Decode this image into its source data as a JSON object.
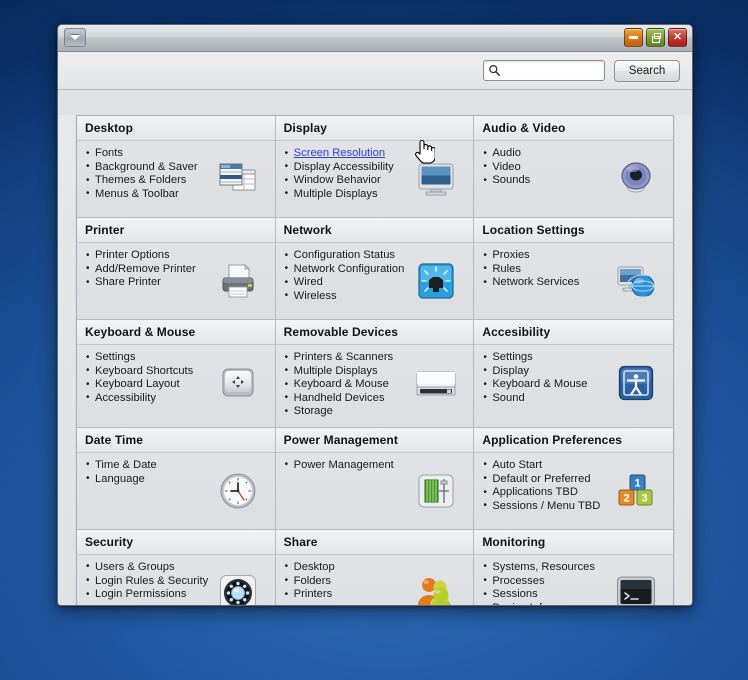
{
  "window": {
    "menu_button_icon": "chevron-down-icon",
    "minimize_label": "–",
    "maximize_label": "□",
    "close_label": "✕"
  },
  "toolbar": {
    "search_icon": "search-icon",
    "search_value": "",
    "search_placeholder": "",
    "search_button_label": "Search"
  },
  "panels": [
    {
      "title": "Desktop",
      "icon": "desktop-windows-icon",
      "items": [
        {
          "label": "Fonts",
          "link": false
        },
        {
          "label": "Background & Saver",
          "link": false
        },
        {
          "label": "Themes & Folders",
          "link": false
        },
        {
          "label": "Menus & Toolbar",
          "link": false
        }
      ]
    },
    {
      "title": "Display",
      "icon": "monitor-icon",
      "items": [
        {
          "label": "Screen Resolution",
          "link": true
        },
        {
          "label": "Display Accessibility",
          "link": false
        },
        {
          "label": "Window Behavior",
          "link": false
        },
        {
          "label": "Multiple Displays",
          "link": false
        }
      ]
    },
    {
      "title": "Audio & Video",
      "icon": "speaker-icon",
      "items": [
        {
          "label": "Audio",
          "link": false
        },
        {
          "label": "Video",
          "link": false
        },
        {
          "label": "Sounds",
          "link": false
        }
      ]
    },
    {
      "title": "Printer",
      "icon": "printer-icon",
      "items": [
        {
          "label": "Printer Options",
          "link": false
        },
        {
          "label": "Add/Remove Printer",
          "link": false
        },
        {
          "label": "Share Printer",
          "link": false
        }
      ]
    },
    {
      "title": "Network",
      "icon": "network-port-icon",
      "items": [
        {
          "label": "Configuration Status",
          "link": false
        },
        {
          "label": "Network Configuration",
          "link": false
        },
        {
          "label": "Wired",
          "link": false
        },
        {
          "label": "Wireless",
          "link": false
        }
      ]
    },
    {
      "title": "Location Settings",
      "icon": "monitor-globe-icon",
      "items": [
        {
          "label": "Proxies",
          "link": false
        },
        {
          "label": "Rules",
          "link": false
        },
        {
          "label": "Network Services",
          "link": false
        }
      ]
    },
    {
      "title": "Keyboard & Mouse",
      "icon": "keyboard-key-icon",
      "items": [
        {
          "label": "Settings",
          "link": false
        },
        {
          "label": "Keyboard Shortcuts",
          "link": false
        },
        {
          "label": "Keyboard Layout",
          "link": false
        },
        {
          "label": "Accessibility",
          "link": false
        }
      ]
    },
    {
      "title": "Removable Devices",
      "icon": "floppy-drive-icon",
      "items": [
        {
          "label": "Printers & Scanners",
          "link": false
        },
        {
          "label": "Multiple Displays",
          "link": false
        },
        {
          "label": "Keyboard & Mouse",
          "link": false
        },
        {
          "label": "Handheld Devices",
          "link": false
        },
        {
          "label": "Storage",
          "link": false
        }
      ]
    },
    {
      "title": "Accesibility",
      "icon": "accessibility-person-icon",
      "items": [
        {
          "label": "Settings",
          "link": false
        },
        {
          "label": "Display",
          "link": false
        },
        {
          "label": "Keyboard & Mouse",
          "link": false
        },
        {
          "label": "Sound",
          "link": false
        }
      ]
    },
    {
      "title": "Date Time",
      "icon": "clock-icon",
      "items": [
        {
          "label": "Time & Date",
          "link": false
        },
        {
          "label": "Language",
          "link": false
        }
      ]
    },
    {
      "title": "Power Management",
      "icon": "battery-icon",
      "items": [
        {
          "label": "Power Management",
          "link": false
        }
      ]
    },
    {
      "title": "Application Preferences",
      "icon": "numbered-blocks-icon",
      "items": [
        {
          "label": "Auto Start",
          "link": false
        },
        {
          "label": "Default or Preferred",
          "link": false
        },
        {
          "label": "Applications TBD",
          "link": false
        },
        {
          "label": "Sessions / Menu TBD",
          "link": false
        }
      ]
    },
    {
      "title": "Security",
      "icon": "gear-shield-icon",
      "items": [
        {
          "label": "Users & Groups",
          "link": false
        },
        {
          "label": "Login Rules & Security",
          "link": false
        },
        {
          "label": "Login Permissions",
          "link": false
        }
      ]
    },
    {
      "title": "Share",
      "icon": "users-group-icon",
      "items": [
        {
          "label": "Desktop",
          "link": false
        },
        {
          "label": "Folders",
          "link": false
        },
        {
          "label": "Printers",
          "link": false
        }
      ]
    },
    {
      "title": "Monitoring",
      "icon": "terminal-icon",
      "items": [
        {
          "label": "Systems, Resources",
          "link": false
        },
        {
          "label": "Processes",
          "link": false
        },
        {
          "label": "Sessions",
          "link": false
        },
        {
          "label": "Device Info",
          "link": false
        }
      ]
    }
  ],
  "cursor": {
    "type": "pointing-hand-cursor"
  },
  "colors": {
    "desktop_blue": "#1b4e95",
    "link_blue": "#2b3fd4",
    "window_chrome": "#dfe1e4",
    "close_red": "#c3352c",
    "max_green": "#7d9e30",
    "min_orange": "#d4761a"
  }
}
